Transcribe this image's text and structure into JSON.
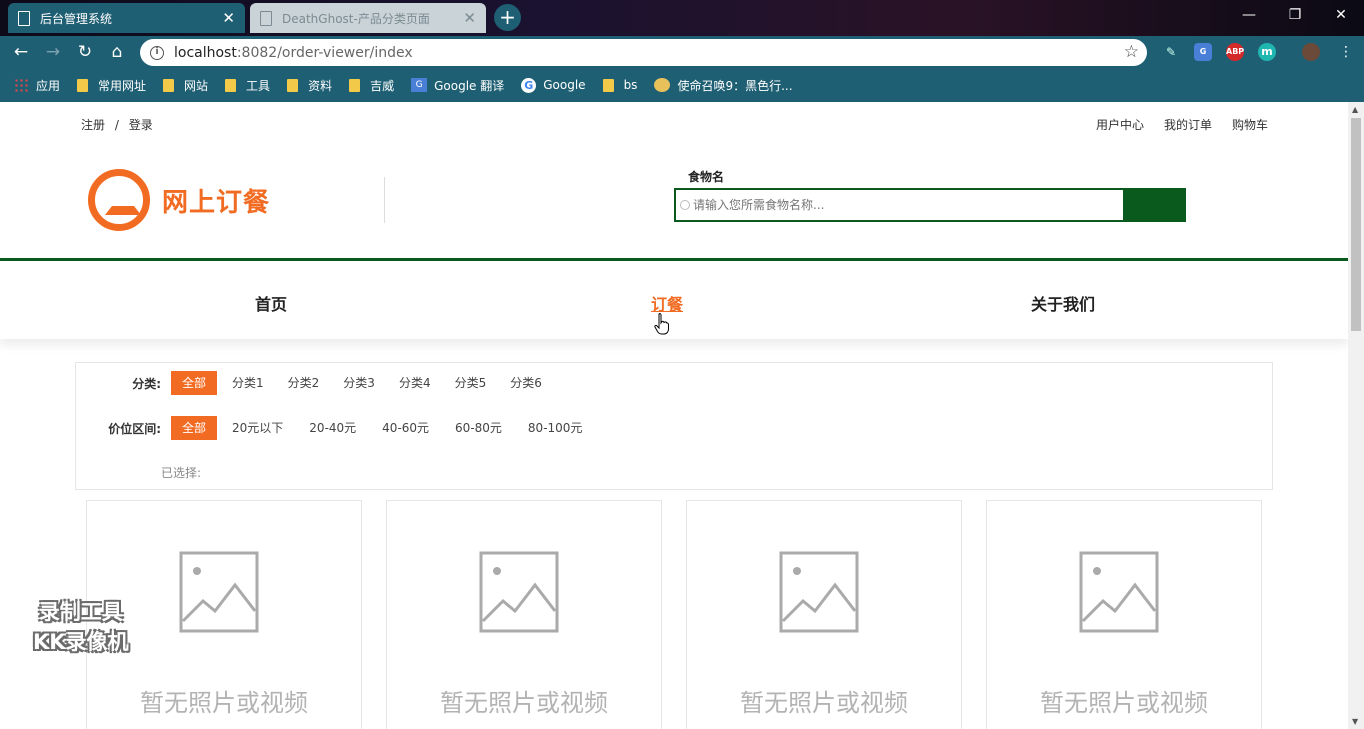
{
  "browser": {
    "tabs": [
      {
        "title": "后台管理系统",
        "active": true
      },
      {
        "title": "DeathGhost-产品分类页面",
        "active": false
      }
    ],
    "address": {
      "host": "localhost",
      "path": ":8082/order-viewer/index"
    },
    "bookmarks": [
      {
        "label": "应用",
        "icon": "apps-grid-icon"
      },
      {
        "label": "常用网址",
        "icon": "folder-icon"
      },
      {
        "label": "网站",
        "icon": "folder-icon"
      },
      {
        "label": "工具",
        "icon": "folder-icon"
      },
      {
        "label": "资料",
        "icon": "folder-icon"
      },
      {
        "label": "吉威",
        "icon": "folder-icon"
      },
      {
        "label": "Google 翻译",
        "icon": "google-translate-icon"
      },
      {
        "label": "Google",
        "icon": "google-icon"
      },
      {
        "label": "bs",
        "icon": "folder-icon"
      },
      {
        "label": "使命召唤9：黑色行...",
        "icon": "game-icon"
      }
    ],
    "extensions": [
      "ABP",
      "m"
    ]
  },
  "page": {
    "top_left": {
      "register": "注册",
      "sep": "/",
      "login": "登录"
    },
    "top_right": [
      "用户中心",
      "我的订单",
      "购物车"
    ],
    "logo_text": "网上订餐",
    "search": {
      "label": "食物名",
      "placeholder": "请输入您所需食物名称..."
    },
    "nav": [
      {
        "label": "首页",
        "active": false
      },
      {
        "label": "订餐",
        "active": true
      },
      {
        "label": "关于我们",
        "active": false
      }
    ],
    "filter": {
      "category_label": "分类:",
      "categories": [
        "全部",
        "分类1",
        "分类2",
        "分类3",
        "分类4",
        "分类5",
        "分类6"
      ],
      "price_label": "价位区间:",
      "prices": [
        "全部",
        "20元以下",
        "20-40元",
        "40-60元",
        "60-80元",
        "80-100元"
      ],
      "selected_label": "已选择:"
    },
    "products": [
      {
        "caption": "暂无照片或视频"
      },
      {
        "caption": "暂无照片或视频"
      },
      {
        "caption": "暂无照片或视频"
      },
      {
        "caption": "暂无照片或视频"
      }
    ]
  },
  "watermark": {
    "line1": "录制工具",
    "line2": "KK录像机"
  },
  "colors": {
    "accent": "#f26b22",
    "brand_green": "#0a5a1e",
    "chrome": "#1f5f73"
  }
}
